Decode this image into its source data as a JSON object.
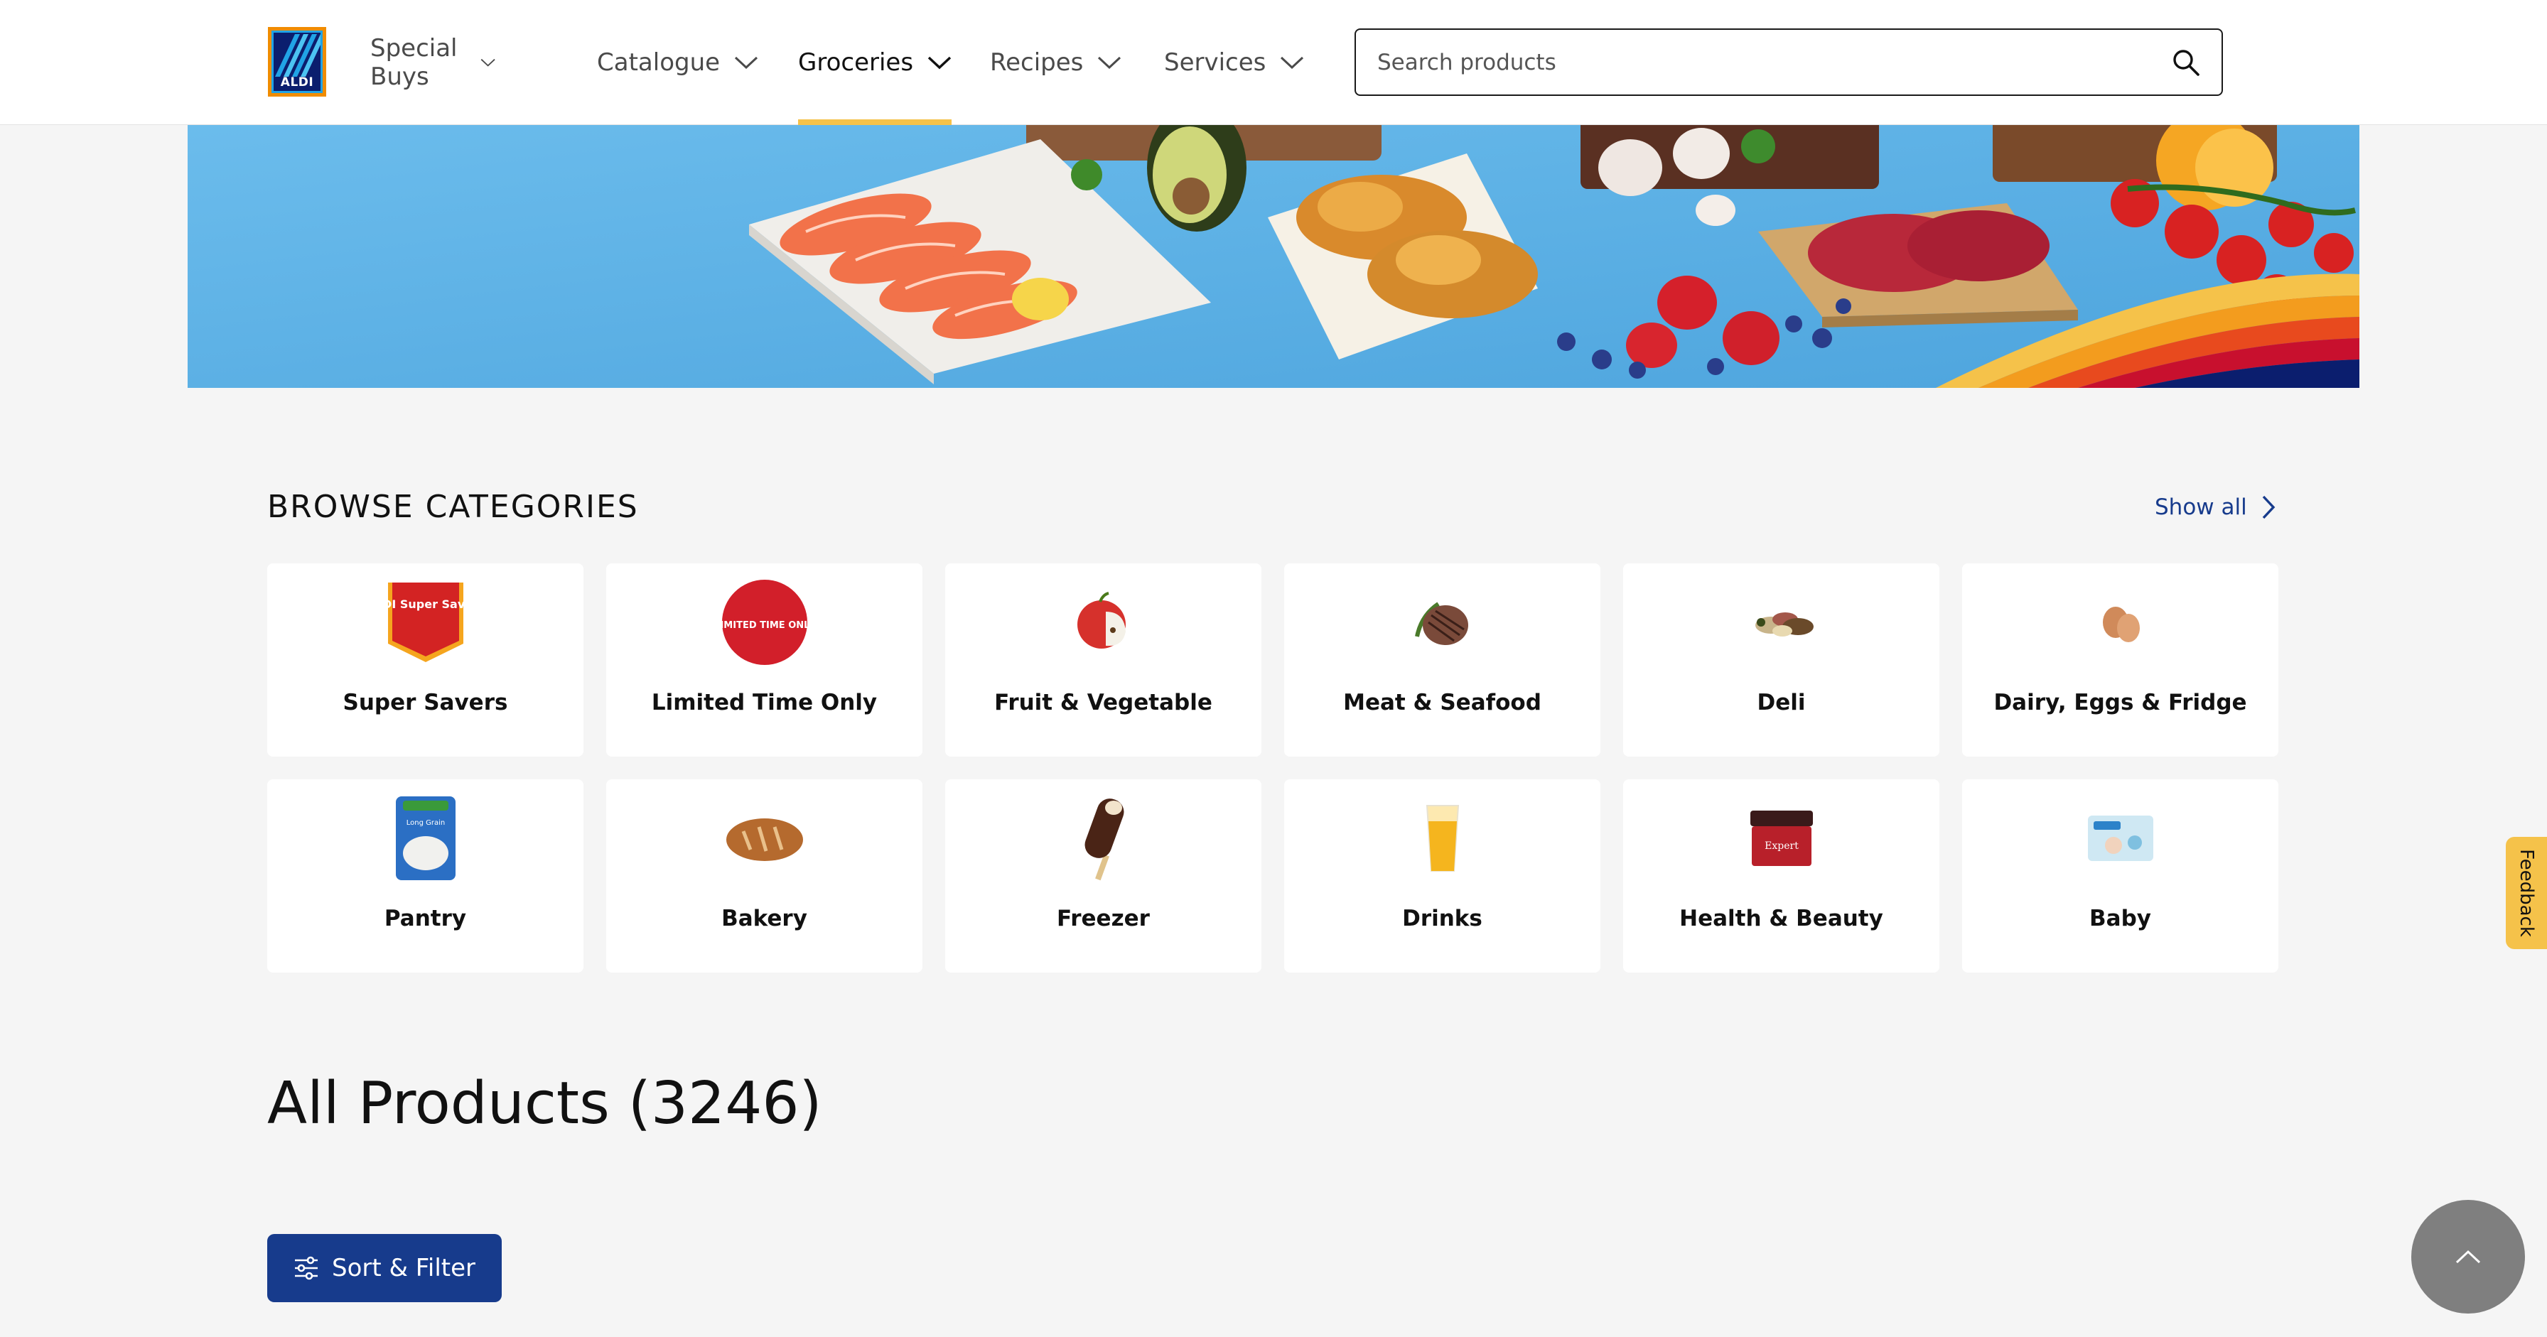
{
  "header": {
    "logo_text": "ALDI",
    "nav": [
      {
        "label": "Special Buys"
      },
      {
        "label": "Catalogue"
      },
      {
        "label": "Groceries"
      },
      {
        "label": "Recipes"
      },
      {
        "label": "Services"
      }
    ],
    "active_nav": "Groceries",
    "search": {
      "placeholder": "Search products",
      "value": ""
    }
  },
  "browse": {
    "title": "BROWSE CATEGORIES",
    "show_all": "Show all",
    "categories": [
      {
        "label": "Super Savers",
        "icon": "super-savers-icon",
        "icon_text": "ALDI Super Savers"
      },
      {
        "label": "Limited Time Only",
        "icon": "limited-time-icon",
        "icon_text": "LIMITED TIME ONLY"
      },
      {
        "label": "Fruit & Vegetable",
        "icon": "apple-icon"
      },
      {
        "label": "Meat & Seafood",
        "icon": "steak-icon"
      },
      {
        "label": "Deli",
        "icon": "deli-icon"
      },
      {
        "label": "Dairy, Eggs & Fridge",
        "icon": "eggs-icon"
      },
      {
        "label": "Pantry",
        "icon": "rice-pack-icon",
        "icon_text": "Long Grain"
      },
      {
        "label": "Bakery",
        "icon": "bread-icon"
      },
      {
        "label": "Freezer",
        "icon": "ice-cream-icon"
      },
      {
        "label": "Drinks",
        "icon": "juice-glass-icon"
      },
      {
        "label": "Health & Beauty",
        "icon": "cream-jar-icon",
        "icon_text": "Expert"
      },
      {
        "label": "Baby",
        "icon": "nappies-icon"
      }
    ]
  },
  "products": {
    "title": "All Products (3246)",
    "sort_filter": "Sort & Filter"
  },
  "feedback": "Feedback",
  "colors": {
    "brand_blue": "#173b8c",
    "accent_yellow": "#f5c24a",
    "page_bg": "#f5f5f5",
    "hero_bg": "#5fb2e6"
  }
}
